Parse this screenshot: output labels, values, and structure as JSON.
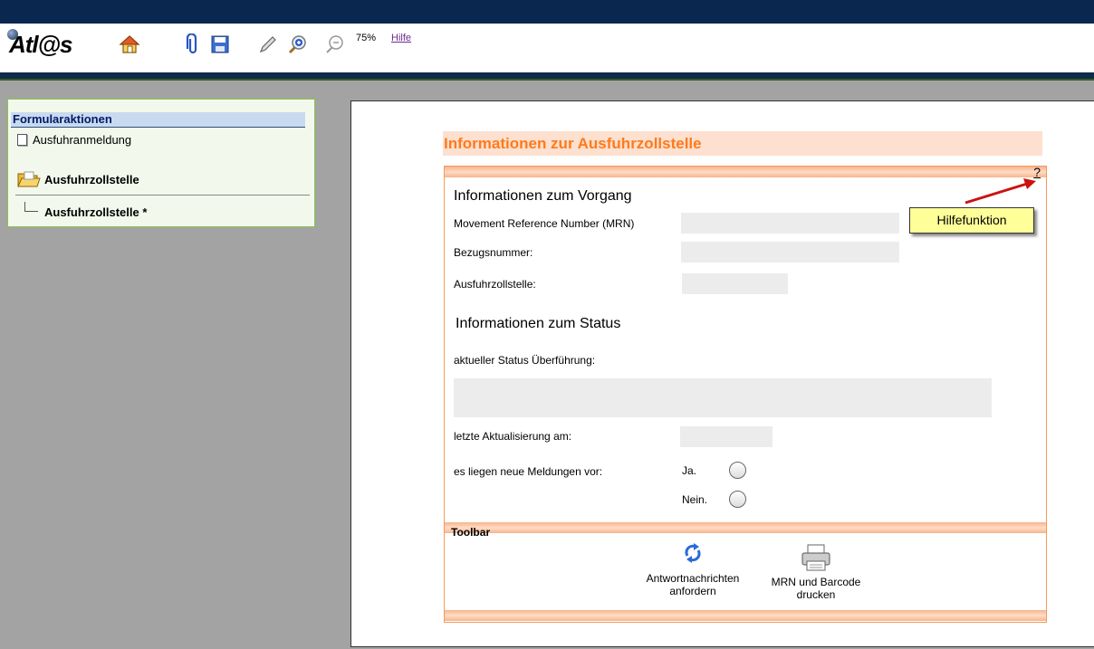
{
  "toolbar": {
    "logo": "Atl@s",
    "zoom": "75%",
    "help_link": "Hilfe"
  },
  "sidebar": {
    "header": "Formularaktionen",
    "item": "Ausfuhranmeldung",
    "folder": "Ausfuhrzollstelle",
    "subitem": "Ausfuhrzollstelle *"
  },
  "form": {
    "title": "Informationen zur Ausfuhrzollstelle",
    "help_marker": "?",
    "tooltip": "Hilfefunktion",
    "section_vorgang": "Informationen zum Vorgang",
    "label_mrn": "Movement Reference Number (MRN)",
    "label_bezugsnummer": "Bezugsnummer:",
    "label_ausfuhrzollstelle": "Ausfuhrzollstelle:",
    "section_status": "Informationen zum Status",
    "label_status": "aktueller Status Überführung:",
    "label_aktualisierung": "letzte Aktualisierung am:",
    "label_meldungen": "es liegen neue Meldungen vor:",
    "radio_ja": "Ja.",
    "radio_nein": "Nein.",
    "toolbar_label": "Toolbar",
    "btn_antwort_l1": "Antwortnachrichten",
    "btn_antwort_l2": "anfordern",
    "btn_drucken_l1": "MRN und Barcode",
    "btn_drucken_l2": "drucken"
  },
  "colors": {
    "accent_orange": "#ff7a1a",
    "title_bg": "#fde0cf",
    "topbar": "#0a2750",
    "tooltip_bg": "#ffff99"
  }
}
